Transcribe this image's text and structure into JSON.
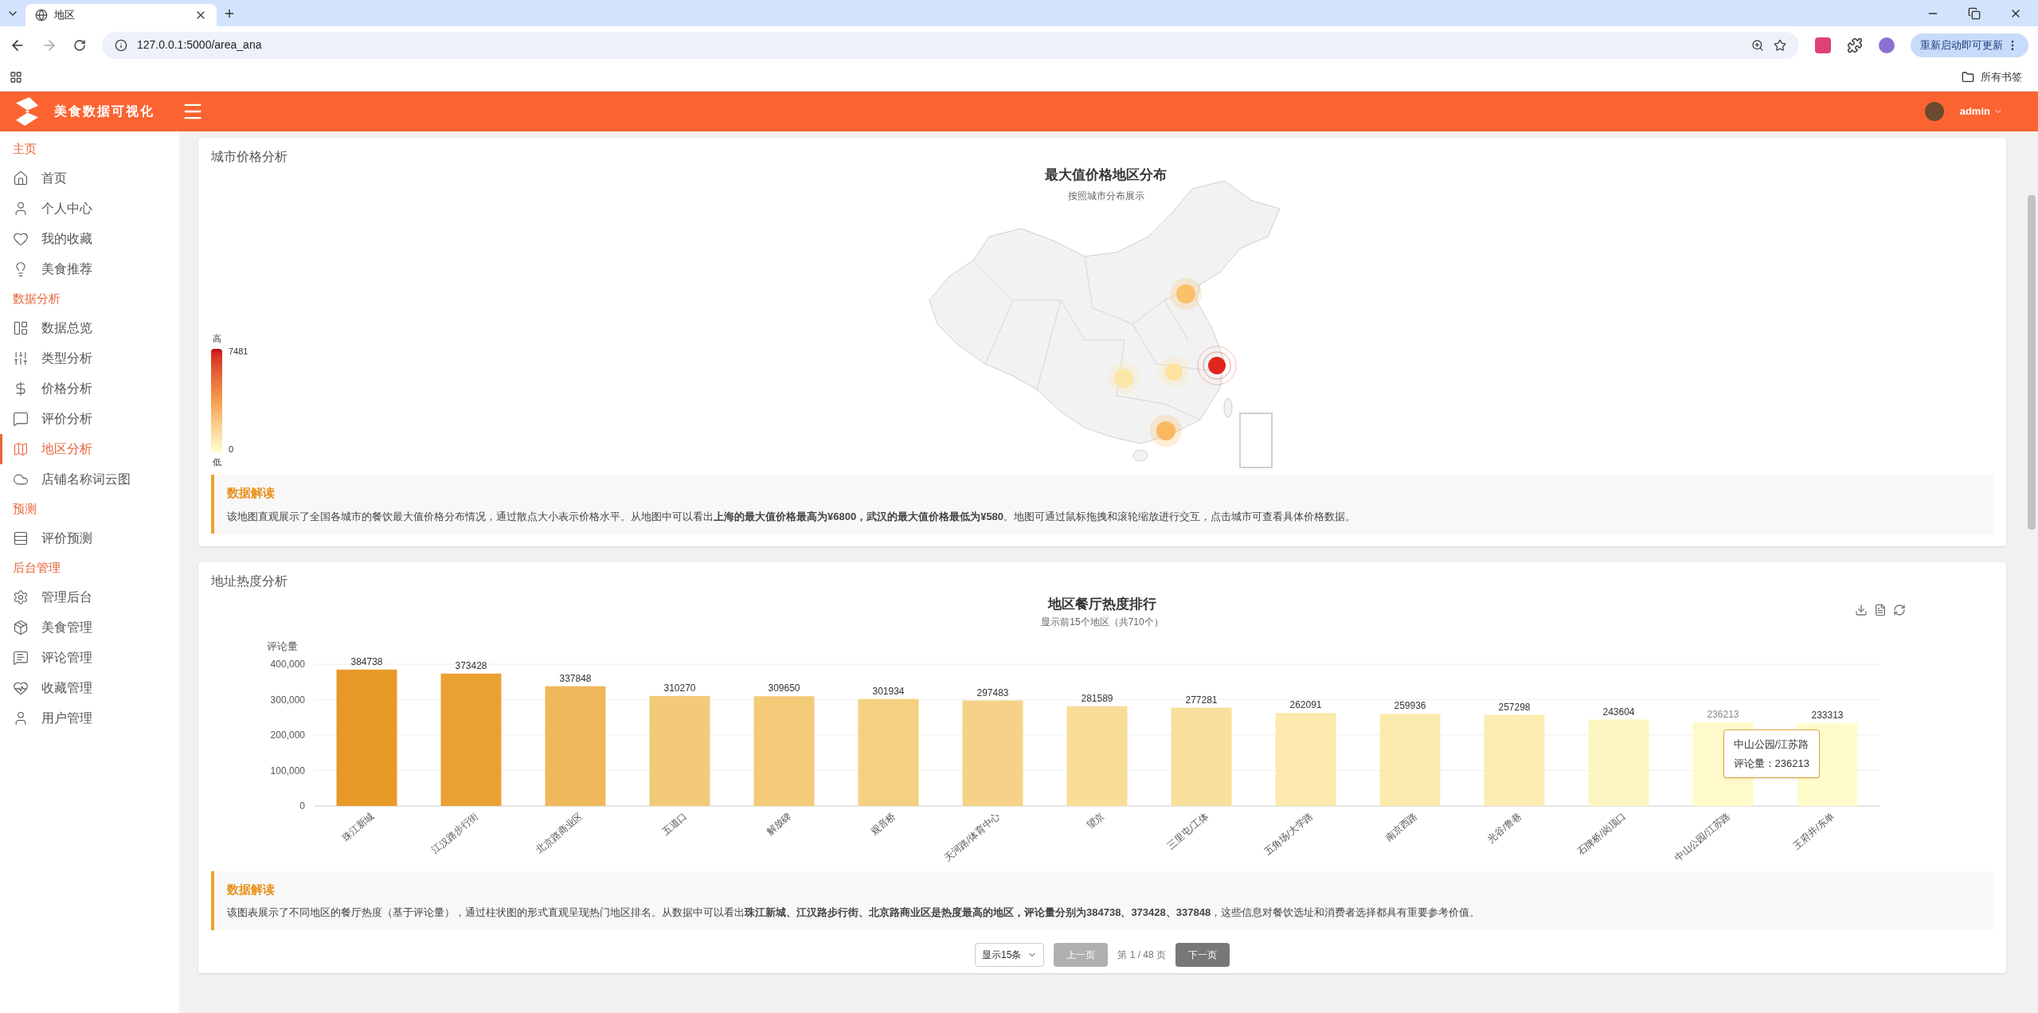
{
  "browser": {
    "tab_title": "地区",
    "url": "127.0.0.1:5000/area_ana",
    "update_button": "重新启动即可更新",
    "bookmarks_label": "所有书签"
  },
  "header": {
    "brand": "美食数据可视化",
    "user": "admin"
  },
  "sidebar": {
    "sections": [
      {
        "title": "主页",
        "items": [
          {
            "label": "首页",
            "kind": "home",
            "selected": false
          },
          {
            "label": "个人中心",
            "kind": "user",
            "selected": false
          },
          {
            "label": "我的收藏",
            "kind": "heart",
            "selected": false
          },
          {
            "label": "美食推荐",
            "kind": "bulb",
            "selected": false
          }
        ]
      },
      {
        "title": "数据分析",
        "items": [
          {
            "label": "数据总览",
            "kind": "layout",
            "selected": false
          },
          {
            "label": "类型分析",
            "kind": "sliders",
            "selected": false
          },
          {
            "label": "价格分析",
            "kind": "dollar",
            "selected": false
          },
          {
            "label": "评价分析",
            "kind": "comment",
            "selected": false
          },
          {
            "label": "地区分析",
            "kind": "map",
            "selected": true
          },
          {
            "label": "店铺名称词云图",
            "kind": "cloud",
            "selected": false
          }
        ]
      },
      {
        "title": "预测",
        "items": [
          {
            "label": "评价预测",
            "kind": "rows",
            "selected": false
          }
        ]
      },
      {
        "title": "后台管理",
        "items": [
          {
            "label": "管理后台",
            "kind": "gear",
            "selected": false
          },
          {
            "label": "美食管理",
            "kind": "box",
            "selected": false
          },
          {
            "label": "评论管理",
            "kind": "message",
            "selected": false
          },
          {
            "label": "收藏管理",
            "kind": "pulse",
            "selected": false
          },
          {
            "label": "用户管理",
            "kind": "user",
            "selected": false
          }
        ]
      }
    ]
  },
  "city_price": {
    "title": "城市价格分析",
    "map_title": "最大值价格地区分布",
    "map_subtitle": "按照城市分布展示",
    "legend": {
      "high": "高",
      "low": "低",
      "max": "7481",
      "min": "0"
    },
    "note": {
      "heading": "数据解读",
      "text": "该地图直观展示了全国各城市的餐饮最大值价格分布情况，通过散点大小表示价格水平。从地图中可以看出**上海的最大值价格最高为¥6800，武汉的最大值价格最低为¥580**。地图可通过鼠标拖拽和滚轮缩放进行交互，点击城市可查看具体价格数据。"
    }
  },
  "area_heat": {
    "title": "地址热度分析",
    "subtitle": "显示前15个地区（共710个）",
    "chart_data": {
      "type": "bar",
      "title": "地区餐厅热度排行",
      "ylabel": "评论量",
      "data_labels": true,
      "grid": true,
      "categories": [
        "珠江新城",
        "江汉路步行街",
        "北京路商业区",
        "五道口",
        "解放碑",
        "观音桥",
        "天河路/体育中心",
        "望京",
        "三里屯/工体",
        "五角场/大学路",
        "南京西路",
        "光谷/鲁巷",
        "石牌桥/岗顶口",
        "中山公园/江苏路",
        "王府井/东单"
      ],
      "series": [
        {
          "colors": [
            "#e89a28",
            "#eaa134",
            "#efb85b",
            "#f3ca79",
            "#f3cb79",
            "#f5d082",
            "#f5d287",
            "#f8dd98",
            "#f8e09c",
            "#fbe9ad",
            "#fbebaf",
            "#fbecb2",
            "#fdf5c1",
            "#fffac9",
            "#fffccc"
          ],
          "values": [
            384738,
            373428,
            337848,
            310270,
            309650,
            301934,
            297483,
            281589,
            277281,
            262091,
            259936,
            257298,
            243604,
            236213,
            233313
          ]
        }
      ],
      "ylim": [
        0,
        400000
      ],
      "yticks": [
        {
          "value": 0,
          "label": "0"
        },
        {
          "value": 100000,
          "label": "100,000"
        },
        {
          "value": 200000,
          "label": "200,000"
        },
        {
          "value": 300000,
          "label": "300,000"
        },
        {
          "value": 400000,
          "label": "400,000"
        }
      ]
    },
    "tooltip": {
      "title": "中山公园/江苏路",
      "text": "评论量：236213"
    },
    "note": {
      "heading": "数据解读",
      "text": "该图表展示了不同地区的餐厅热度（基于评论量），通过柱状图的形式直观呈现热门地区排名。从数据中可以看出**珠江新城、江汉路步行街、北京路商业区是热度最高的地区，评论量分别为384738、373428、337848**，这些信息对餐饮选址和消费者选择都具有重要参考价值。"
    },
    "pagination": {
      "page_size": "显示15条",
      "prev": {
        "label": "上一页",
        "disabled": true
      },
      "page_info": "第 1 / 48 页",
      "next": {
        "label": "下一页",
        "disabled": false
      }
    }
  }
}
